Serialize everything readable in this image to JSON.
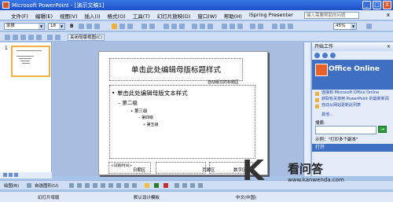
{
  "window": {
    "title": "Microsoft PowerPoint - [演示文稿1]",
    "controls": [
      "_",
      "□",
      "X"
    ]
  },
  "menubar": {
    "items": [
      "文件(F)",
      "编辑(E)",
      "视图(V)",
      "插入(I)",
      "格式(O)",
      "工具(T)",
      "幻灯片放映(D)",
      "窗口(W)",
      "帮助(H)",
      "iSpring Presenter"
    ],
    "help_placeholder": "键入需要帮助的问题",
    "close": "x"
  },
  "toolbar": {
    "font": "宋体",
    "size": "18",
    "bold": "B",
    "zoom": "45%"
  },
  "master_toolbar": {
    "close_label": "关闭母版视图(C)"
  },
  "thumbnail": {
    "number": "1"
  },
  "slide": {
    "title": "单击此处编辑母版标题样式",
    "title_note": "自动版式的标题区",
    "levels": [
      "单击此处编辑母版文本样式",
      "第二级",
      "第三级",
      "第四级",
      "第五级"
    ],
    "footer_date_label": "<日期/时间>",
    "footer_date_area": "日期区",
    "footer_num_area": "页脚区",
    "footer_num": "数字区"
  },
  "taskpane": {
    "header": "开始工作",
    "office_online": "Office Online",
    "links": [
      "连接到 Microsoft Office Online",
      "获取有关使用 PowerPoint 的最新新闻",
      "自动从网站更新此列表"
    ],
    "more": "其他...",
    "search_label": "搜索:",
    "example": "示例：\"打印多个副本\"",
    "open_header": "打开"
  },
  "drawbar": {
    "draw": "绘图(R)",
    "autoshapes": "自选图形(U)"
  },
  "statusbar": {
    "left": "幻灯片母版",
    "center": "默认设计模板",
    "right": "中文(中国)"
  },
  "watermark": {
    "logo": "K",
    "name": "看问答",
    "url": "www.kanwenda.com"
  }
}
